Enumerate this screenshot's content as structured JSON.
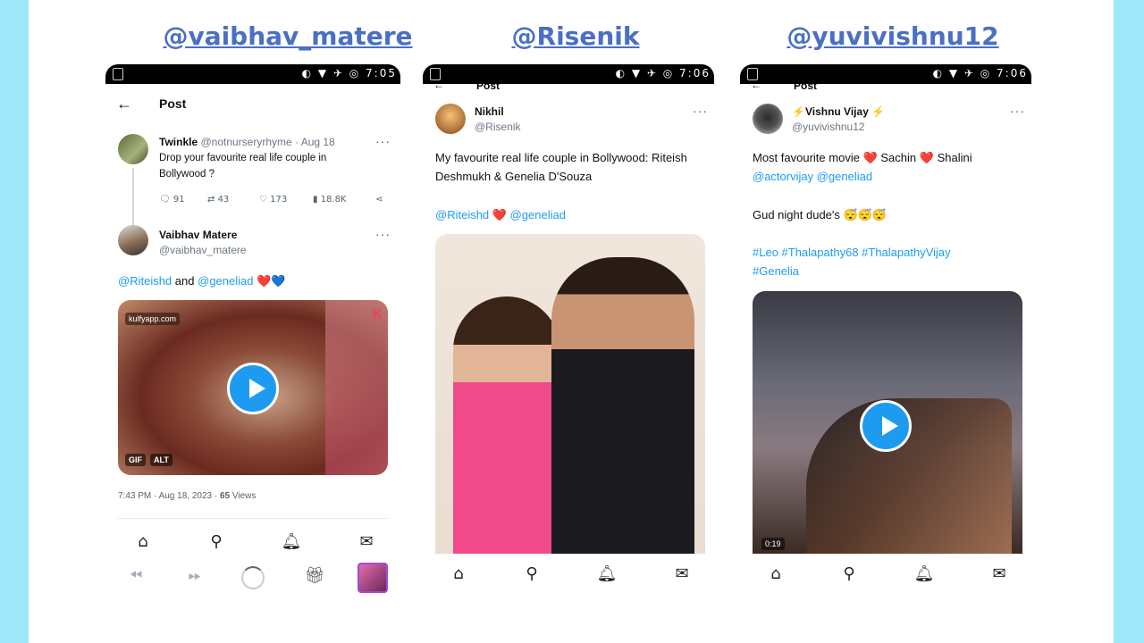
{
  "colors": {
    "accent": "#1d9bf0",
    "handle": "#4a6fc4",
    "heart_red": "#e0245e",
    "heart_blue": "#3aa0ff",
    "bg_cyan": "#9fe8f9"
  },
  "handles": [
    "@vaibhav_matere",
    "@Risenik",
    "@yuvivishnu12"
  ],
  "status_time": "7:05",
  "status_time2": "7:06",
  "post_title": "Post",
  "phone1": {
    "parent": {
      "name": "Twinkle",
      "handle": "@notnurseryrhyme · Aug 18",
      "text": "Drop your favourite real life couple in Bollywood ?",
      "replies": "91",
      "retweets": "43",
      "likes": "173",
      "views": "18.8K"
    },
    "reply": {
      "name": "Vaibhav Matere",
      "handle": "@vaibhav_matere",
      "mention1": "@Riteishd",
      "and": "and",
      "mention2": "@geneliad",
      "hearts": "❤️💙"
    },
    "media": {
      "watermark": "kulfyapp.com",
      "gif_badge": "GIF",
      "alt_badge": "ALT",
      "corner": "K"
    },
    "meta": {
      "time": "7:43 PM · Aug 18, 2023 · ",
      "views_count": "65",
      "views_label": " Views"
    }
  },
  "phone2": {
    "name": "Nikhil",
    "handle": "@Risenik",
    "text": "My favourite real life couple in Bollywood: Riteish Deshmukh & Genelia D'Souza",
    "mention1": "@Riteishd",
    "heart": "❤️",
    "mention2": "@geneliad"
  },
  "phone3": {
    "name": "⚡Vishnu Vijay ⚡",
    "handle": "@yuvivishnu12",
    "text_a": "Most favourite movie",
    "heart1": "❤️",
    "text_b": "Sachin",
    "heart2": "❤️",
    "text_c": "Shalini",
    "mention1": "@actorvijay",
    "mention2": "@geneliad",
    "goodnight": "Gud night dude's 😴😴😴",
    "tags": "#Leo #Thalapathy68 #ThalapathyVijay",
    "tag2": "#Genelia",
    "duration": "0:19"
  },
  "nav_icons": [
    "home-icon",
    "search-icon",
    "bell-icon",
    "mail-icon"
  ],
  "android_nav": [
    "rewind-icon",
    "forward-icon",
    "loading-icon",
    "gift-icon",
    "thumbnail"
  ]
}
